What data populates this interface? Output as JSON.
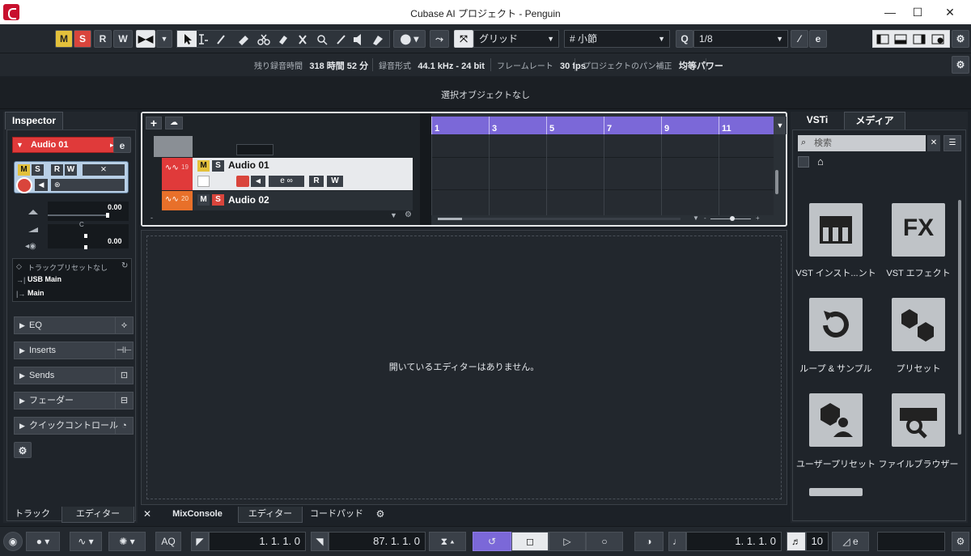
{
  "window": {
    "title": "Cubase AI プロジェクト - Penguin",
    "minimize": "—",
    "maximize": "☐",
    "close": "✕"
  },
  "toolbar": {
    "mute_label": "M",
    "solo_label": "S",
    "read_label": "R",
    "write_label": "W",
    "snap_type": "グリッド",
    "grid_type": "小節",
    "grid_prefix": "#",
    "quantize_label": "Q",
    "quantize_value": "1/8"
  },
  "info": {
    "remaining_label": "残り録音時間",
    "remaining_value": "318 時間 52 分",
    "format_label": "録音形式",
    "format_value": "44.1 kHz - 24 bit",
    "framerate_label": "フレームレート",
    "framerate_value": "30 fps",
    "pan_label": "プロジェクトのパン補正",
    "panlaw_label": "均等パワー"
  },
  "event_info": "選択オブジェクトなし",
  "inspector": {
    "tab": "Inspector",
    "track_name": "Audio 01",
    "m": "M",
    "s": "S",
    "r": "R",
    "w": "W",
    "volume": "0.00",
    "pan_center": "C",
    "pan_value": "0.00",
    "preset": "トラックプリセットなし",
    "input": "USB Main",
    "output": "Main",
    "sections": [
      "EQ",
      "Inserts",
      "Sends",
      "フェーダー",
      "クイックコントロール"
    ]
  },
  "tracks": [
    {
      "number": "19",
      "name": "Audio 01",
      "color": "#e03a3a"
    },
    {
      "number": "20",
      "name": "Audio 02",
      "color": "#e8702a"
    }
  ],
  "track_buttons": {
    "m": "M",
    "s": "S",
    "r": "R",
    "w": "W",
    "e": "e"
  },
  "ruler": [
    "1",
    "3",
    "5",
    "7",
    "9",
    "11"
  ],
  "editor": {
    "message": "開いているエディターはありません。"
  },
  "bottom_tabs": {
    "track": "トラック",
    "editor": "エディター",
    "close": "✕",
    "mixconsole": "MixConsole",
    "editor2": "エディター",
    "chordpad": "コードパッド"
  },
  "right_zone": {
    "tab_vsti": "VSTi",
    "tab_media": "メディア",
    "search_placeholder": "検索",
    "search_clear": "✕",
    "tiles": [
      {
        "label": "VST インスト...ント",
        "icon": "piano-icon"
      },
      {
        "label": "VST エフェクト",
        "icon": "fx-icon",
        "glyph": "FX"
      },
      {
        "label": "ループ & サンプル",
        "icon": "loop-icon"
      },
      {
        "label": "プリセット",
        "icon": "preset-icon"
      },
      {
        "label": "ユーザープリセット",
        "icon": "user-preset-icon"
      },
      {
        "label": "ファイルブラウザー",
        "icon": "file-browser-icon"
      }
    ]
  },
  "transport": {
    "aq": "AQ",
    "left_locator": "1. 1. 1.   0",
    "right_locator": "87. 1. 1.   0",
    "position": "1. 1. 1.   0",
    "tempo": "10"
  },
  "colors": {
    "accent_purple": "#7b68d8",
    "track_red": "#e03a3a",
    "mute_yellow": "#e3c13b",
    "solo_red": "#d9453c"
  }
}
